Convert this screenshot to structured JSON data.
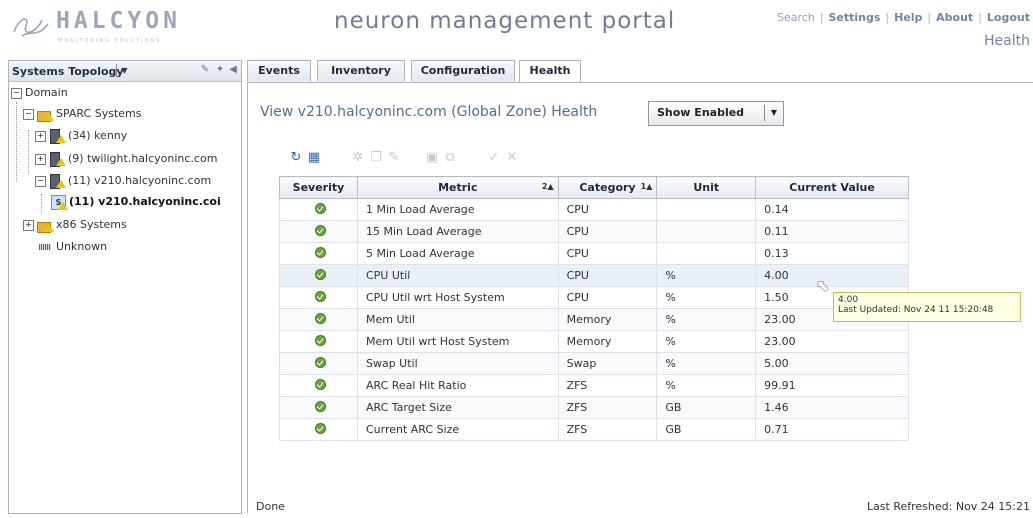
{
  "brand": {
    "name": "HALCYON",
    "tagline": "MONITORING SOLUTIONS"
  },
  "header": {
    "portal_title": "neuron management portal",
    "links": [
      "Search",
      "Settings",
      "Help",
      "About",
      "Logout"
    ],
    "section": "Health"
  },
  "topology": {
    "title": "Systems Topology",
    "nodes": {
      "domain": "Domain",
      "sparc": "SPARC Systems",
      "kenny": "(34) kenny",
      "twilight": "(9) twilight.halcyoninc.com",
      "v210": "(11) v210.halcyoninc.com",
      "v210_zone": "(11) v210.halcyoninc.coi",
      "x86": "x86 Systems",
      "unknown": "Unknown"
    },
    "zone_badge": "S"
  },
  "tabs": [
    "Events",
    "Inventory",
    "Configuration",
    "Health"
  ],
  "active_tab": "Health",
  "view": {
    "title": "View v210.halcyoninc.com (Global Zone) Health",
    "filter_label": "Show Enabled"
  },
  "table": {
    "columns": [
      "Severity",
      "Metric",
      "Category",
      "Unit",
      "Current Value"
    ],
    "sort_markers": {
      "metric": "2▲",
      "category": "1▲"
    },
    "rows": [
      {
        "metric": "1 Min Load Average",
        "category": "CPU",
        "unit": "",
        "value": "0.14"
      },
      {
        "metric": "15 Min Load Average",
        "category": "CPU",
        "unit": "",
        "value": "0.11"
      },
      {
        "metric": "5 Min Load Average",
        "category": "CPU",
        "unit": "",
        "value": "0.13"
      },
      {
        "metric": "CPU Util",
        "category": "CPU",
        "unit": "%",
        "value": "4.00"
      },
      {
        "metric": "CPU Util wrt Host System",
        "category": "CPU",
        "unit": "%",
        "value": "1.50"
      },
      {
        "metric": "Mem Util",
        "category": "Memory",
        "unit": "%",
        "value": "23.00"
      },
      {
        "metric": "Mem Util wrt Host System",
        "category": "Memory",
        "unit": "%",
        "value": "23.00"
      },
      {
        "metric": "Swap Util",
        "category": "Swap",
        "unit": "%",
        "value": "5.00"
      },
      {
        "metric": "ARC Real Hit Ratio",
        "category": "ZFS",
        "unit": "%",
        "value": "99.91"
      },
      {
        "metric": "ARC Target Size",
        "category": "ZFS",
        "unit": "GB",
        "value": "1.46"
      },
      {
        "metric": "Current ARC Size",
        "category": "ZFS",
        "unit": "GB",
        "value": "0.71"
      }
    ]
  },
  "tooltip": {
    "value": "4.00",
    "updated": "Last Updated: Nov 24 11 15:20:48"
  },
  "status": {
    "left": "Done",
    "right": "Last Refreshed: Nov 24 15:21"
  },
  "colors": {
    "accent": "#4f6f93",
    "ok": "#6aa93a",
    "warning": "#f1c400"
  }
}
